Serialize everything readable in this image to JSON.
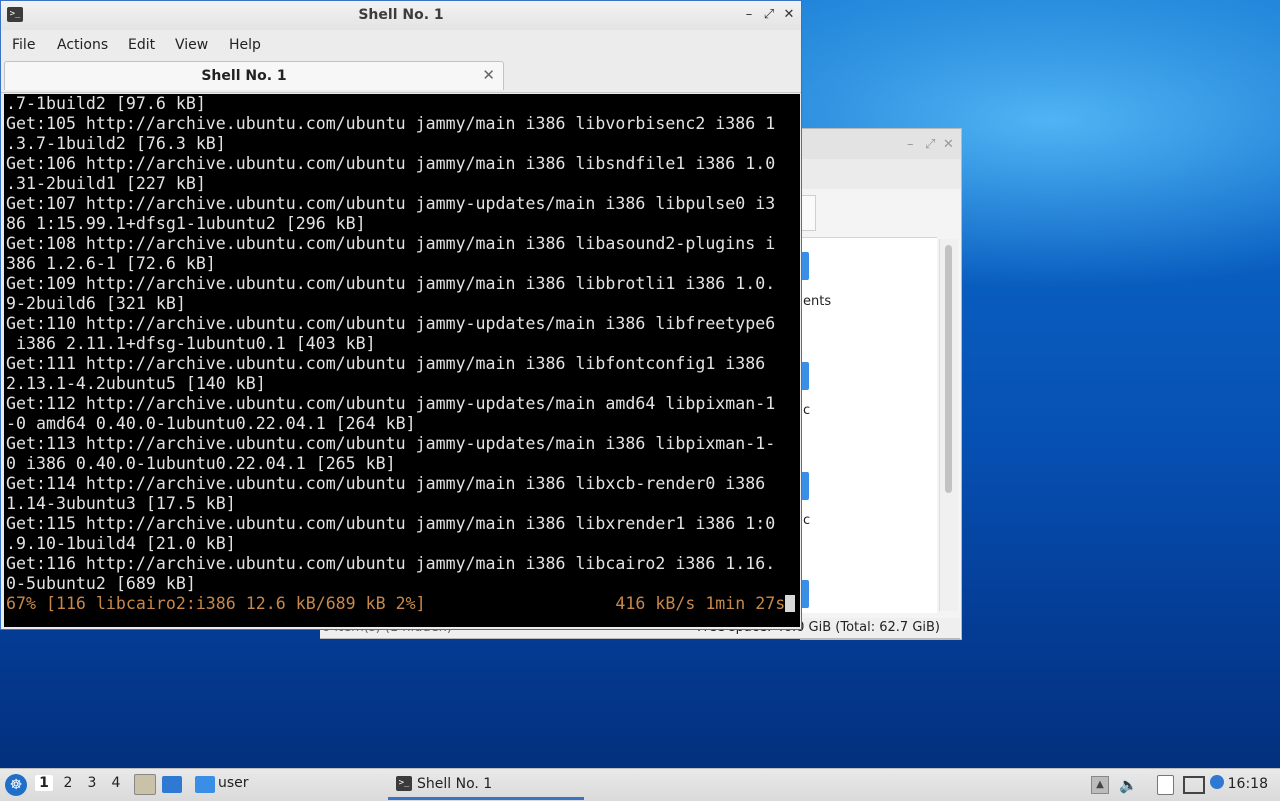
{
  "file_manager": {
    "partial_texts": [
      "ents",
      "c",
      "c"
    ],
    "status_left": "0 item(s) (1 hidden)",
    "status_right": "Free space: 46.0 GiB (Total: 62.7 GiB)"
  },
  "terminal": {
    "window_title": "Shell No. 1",
    "menu": [
      "File",
      "Actions",
      "Edit",
      "View",
      "Help"
    ],
    "tab_label": "Shell No. 1",
    "lines": [
      ".7-1build2 [97.6 kB]",
      "Get:105 http://archive.ubuntu.com/ubuntu jammy/main i386 libvorbisenc2 i386 1",
      ".3.7-1build2 [76.3 kB]",
      "Get:106 http://archive.ubuntu.com/ubuntu jammy/main i386 libsndfile1 i386 1.0",
      ".31-2build1 [227 kB]",
      "Get:107 http://archive.ubuntu.com/ubuntu jammy-updates/main i386 libpulse0 i3",
      "86 1:15.99.1+dfsg1-1ubuntu2 [296 kB]",
      "Get:108 http://archive.ubuntu.com/ubuntu jammy/main i386 libasound2-plugins i",
      "386 1.2.6-1 [72.6 kB]",
      "Get:109 http://archive.ubuntu.com/ubuntu jammy/main i386 libbrotli1 i386 1.0.",
      "9-2build6 [321 kB]",
      "Get:110 http://archive.ubuntu.com/ubuntu jammy-updates/main i386 libfreetype6",
      " i386 2.11.1+dfsg-1ubuntu0.1 [403 kB]",
      "Get:111 http://archive.ubuntu.com/ubuntu jammy/main i386 libfontconfig1 i386",
      "2.13.1-4.2ubuntu5 [140 kB]",
      "Get:112 http://archive.ubuntu.com/ubuntu jammy-updates/main amd64 libpixman-1",
      "-0 amd64 0.40.0-1ubuntu0.22.04.1 [264 kB]",
      "Get:113 http://archive.ubuntu.com/ubuntu jammy-updates/main i386 libpixman-1-",
      "0 i386 0.40.0-1ubuntu0.22.04.1 [265 kB]",
      "Get:114 http://archive.ubuntu.com/ubuntu jammy/main i386 libxcb-render0 i386",
      "1.14-3ubuntu3 [17.5 kB]",
      "Get:115 http://archive.ubuntu.com/ubuntu jammy/main i386 libxrender1 i386 1:0",
      ".9.10-1build4 [21.0 kB]",
      "Get:116 http://archive.ubuntu.com/ubuntu jammy/main i386 libcairo2 i386 1.16.",
      "0-5ubuntu2 [689 kB]"
    ],
    "progress_line": "67% [116 libcairo2:i386 12.6 kB/689 kB 2%]                   416 kB/s 1min 27s",
    "progress_color": "#c8884a"
  },
  "taskbar": {
    "desktops": [
      "1",
      "2",
      "3",
      "4"
    ],
    "active_desktop": "1",
    "folder_label": "user",
    "task_label": "Shell No. 1",
    "clock": "16:18",
    "icons": [
      "start-menu-icon",
      "file-manager-icon",
      "show-desktop-icon",
      "folder-icon",
      "terminal-icon",
      "eject-icon",
      "volume-icon",
      "clipboard-icon",
      "network-icon",
      "update-notifier-icon"
    ],
    "accent": "#3a73c6"
  }
}
